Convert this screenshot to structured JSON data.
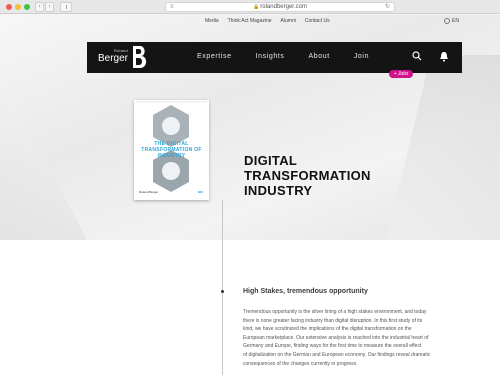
{
  "browser": {
    "url": "rolandberger.com",
    "back_icon": "chevron-left-icon",
    "forward_icon": "chevron-right-icon"
  },
  "utility_nav": {
    "items": [
      "Media",
      "Think:Act Magazine",
      "Alumni",
      "Contact Us"
    ],
    "language": "EN"
  },
  "header": {
    "logo_small": "Roland",
    "logo_name": "Berger",
    "nav": [
      "Expertise",
      "Insights",
      "About",
      "Join"
    ],
    "jobs_tag": "+ Jobs",
    "colors": {
      "bar": "#141414",
      "accent": "#d0138a"
    }
  },
  "hero": {
    "cover": {
      "title": "THE DIGITAL TRANSFORMATION OF INDUSTRY",
      "footer_left": "Roland Berger",
      "footer_right": "BDI"
    },
    "headline": [
      "DIGITAL",
      "TRANSFORMATION",
      "INDUSTRY"
    ]
  },
  "article": {
    "section_title": "High Stakes, tremendous opportunity",
    "body_lines": [
      "Tremendous opportunity is the silver lining of a high stakes environment, and today",
      "there is none greater facing industry than digital disruption. In this first study of its",
      "kind, we have scrutinized the implications of the digital transformation on the",
      "European marketplace. Our extensive analysis is reached into the industrial heart of",
      "Germany and Europe, finding ways for the first time to measure the overall effect",
      "of digitalization on the German and European economy. Our findings reveal dramatic",
      "consequences of the changes currently in progress."
    ]
  }
}
